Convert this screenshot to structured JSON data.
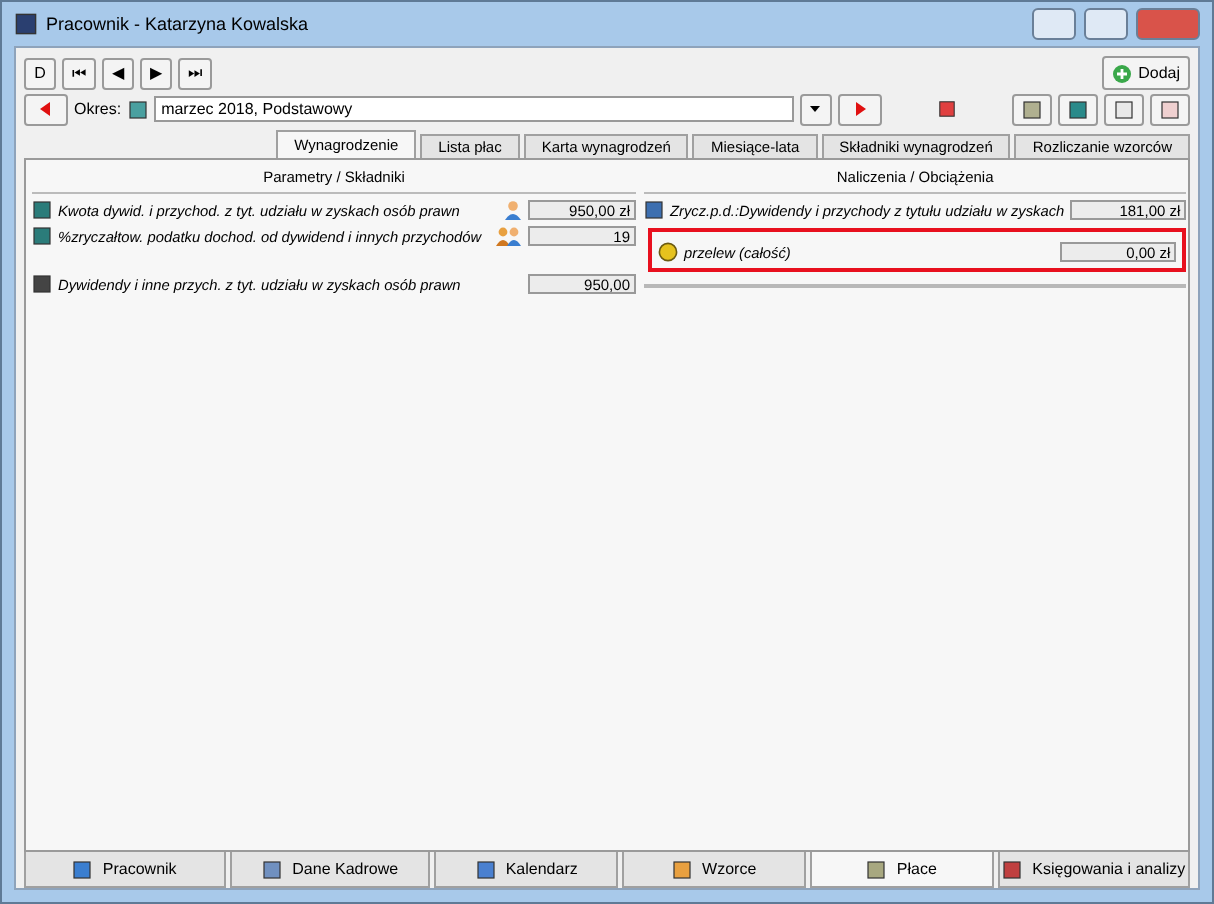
{
  "window": {
    "title": "Pracownik - Katarzyna Kowalska"
  },
  "nav_buttons": [
    {
      "label": "D"
    },
    {
      "label": "⏮"
    },
    {
      "label": "◀"
    },
    {
      "label": "▶"
    },
    {
      "label": "⏭"
    }
  ],
  "add_button": {
    "label": "Dodaj"
  },
  "period": {
    "label": "Okres:",
    "value": "marzec 2018, Podstawowy"
  },
  "tabs": [
    {
      "label": "Wynagrodzenie",
      "selected": true
    },
    {
      "label": "Lista płac",
      "selected": false
    },
    {
      "label": "Karta wynagrodzeń",
      "selected": false
    },
    {
      "label": "Miesiące-lata",
      "selected": false
    },
    {
      "label": "Składniki wynagrodzeń",
      "selected": false
    },
    {
      "label": "Rozliczanie wzorców",
      "selected": false
    }
  ],
  "left_panel": {
    "header": "Parametry / Składniki",
    "rows": [
      {
        "kind": "param",
        "label": "Kwota dywid. i przychod. z tyt. udziału w zyskach osób prawn",
        "value": "950,00 zł",
        "assigned": true,
        "group": false
      },
      {
        "kind": "param",
        "label": "%zryczałtow. podatku dochod. od dywidend i innych przychodów",
        "value": "19",
        "assigned": true,
        "group": true
      },
      {
        "kind": "component",
        "label": "Dywidendy i inne przych. z tyt. udziału w zyskach osób prawn",
        "value": "950,00",
        "assigned": false
      }
    ]
  },
  "right_panel": {
    "header": "Naliczenia / Obciążenia",
    "rows": [
      {
        "kind": "tax",
        "label": "Zrycz.p.d.:Dywidendy i przychody z tytułu udziału w zyskach",
        "value": "181,00 zł",
        "highlighted": false
      },
      {
        "kind": "coin",
        "label": "przelew (całość)",
        "value": "0,00 zł",
        "highlighted": true
      }
    ]
  },
  "bottom_tabs": [
    {
      "label": "Pracownik",
      "selected": false
    },
    {
      "label": "Dane Kadrowe",
      "selected": false
    },
    {
      "label": "Kalendarz",
      "selected": false
    },
    {
      "label": "Wzorce",
      "selected": false
    },
    {
      "label": "Płace",
      "selected": true
    },
    {
      "label": "Księgowania i analizy",
      "selected": false
    }
  ]
}
